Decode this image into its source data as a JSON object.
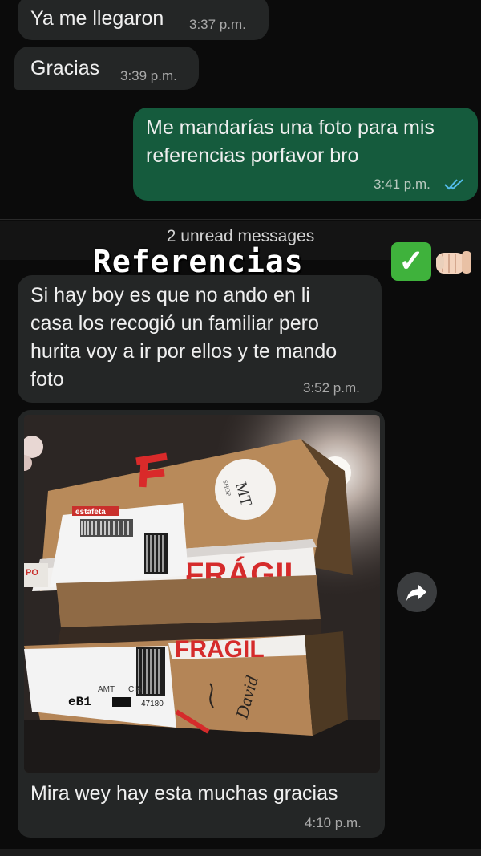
{
  "messages": [
    {
      "text": "Ya me llegaron",
      "time": "3:37 p.m."
    },
    {
      "text": "Gracias",
      "time": "3:39 p.m."
    },
    {
      "lines": [
        "Me mandarías una foto para mis",
        "referencias porfavor bro"
      ],
      "time": "3:41 p.m."
    },
    {
      "lines": [
        "Si hay boy es que no ando en li",
        "casa los recogió un familiar pero",
        "hurita voy a ir por ellos y te mando",
        "foto"
      ],
      "time": "3:52 p.m."
    },
    {
      "caption": "Mira wey hay esta muchas gracias",
      "time": "4:10 p.m."
    }
  ],
  "unread_label": "2 unread messages",
  "overlay": {
    "title": "Referencias",
    "check_emoji": "✅"
  },
  "photo": {
    "description_icons": "package-photo",
    "label_brand": "estafeta",
    "shop_badge_top": "MT",
    "shop_badge_bottom": "SHOP",
    "tape_text_upper": "FRÁGIL",
    "tape_text_lower": "FRAGIL",
    "handwriting": "David",
    "barcode_left": "eB1",
    "barcode_right": "47180",
    "label_extra": "AMT",
    "label_extra2": "CIA",
    "side_label": "PO"
  },
  "colors": {
    "incoming": "#242626",
    "outgoing": "#155b3d",
    "read_ticks": "#53bdeb",
    "check": "#3fb23c"
  }
}
